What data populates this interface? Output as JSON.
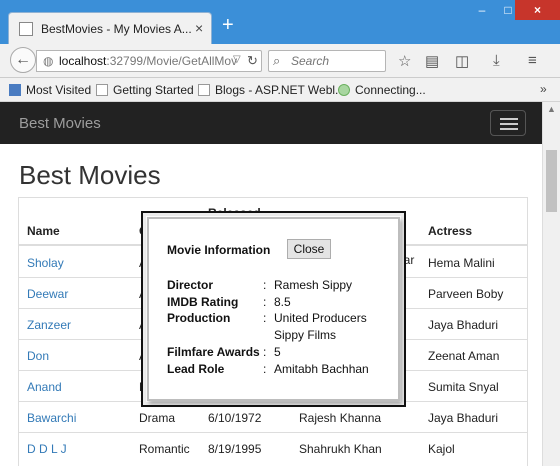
{
  "browser": {
    "tab_title": "BestMovies - My Movies A...",
    "url_host": "localhost",
    "url_path": ":32799/Movie/GetAllMov",
    "search_placeholder": "Search",
    "new_tab": "+",
    "tab_close": "×",
    "back": "←",
    "reload": "↻",
    "bookmarks": [
      "Most Visited",
      "Getting Started",
      "Blogs - ASP.NET Webl...",
      "Connecting..."
    ],
    "bookmarks_overflow": "»",
    "window_controls": {
      "minimize": "–",
      "maximize": "□",
      "close": "×"
    },
    "icons": [
      "globe-icon",
      "search-icon",
      "star-icon",
      "reading-list-icon",
      "pocket-icon",
      "download-icon",
      "menu-icon"
    ]
  },
  "app": {
    "brand": "Best Movies",
    "heading": "Best Movies"
  },
  "table": {
    "headers": {
      "name": "Name",
      "genre": "G",
      "released": "Released",
      "actor_suffix": "dar",
      "actress": "Actress"
    },
    "rows": [
      {
        "name": "Sholay",
        "genre": "A",
        "released": "",
        "actor": "",
        "actress": "Hema Malini"
      },
      {
        "name": "Deewar",
        "genre": "A",
        "released": "",
        "actor": "",
        "actress": "Parveen Boby"
      },
      {
        "name": "Zanzeer",
        "genre": "A",
        "released": "",
        "actor": "",
        "actress": "Jaya Bhaduri"
      },
      {
        "name": "Don",
        "genre": "A",
        "released": "",
        "actor": "",
        "actress": "Zeenat Aman"
      },
      {
        "name": "Anand",
        "genre": "D",
        "released": "",
        "actor": "",
        "actress": "Sumita Snyal"
      },
      {
        "name": "Bawarchi",
        "genre": "Drama",
        "released": "6/10/1972",
        "actor": "Rajesh Khanna",
        "actress": "Jaya Bhaduri"
      },
      {
        "name": "D D L J",
        "genre": "Romantic",
        "released": "8/19/1995",
        "actor": "Shahrukh Khan",
        "actress": "Kajol"
      }
    ]
  },
  "modal": {
    "title": "Movie Information",
    "close_label": "Close",
    "fields": [
      {
        "label": "Director",
        "values": [
          "Ramesh Sippy"
        ]
      },
      {
        "label": "IMDB Rating",
        "values": [
          "8.5"
        ]
      },
      {
        "label": "Production",
        "values": [
          "United Producers",
          "Sippy Films"
        ]
      },
      {
        "label": "Filmfare Awards",
        "values": [
          "5"
        ]
      },
      {
        "label": "Lead Role",
        "values": [
          "Amitabh Bachhan"
        ]
      }
    ]
  }
}
